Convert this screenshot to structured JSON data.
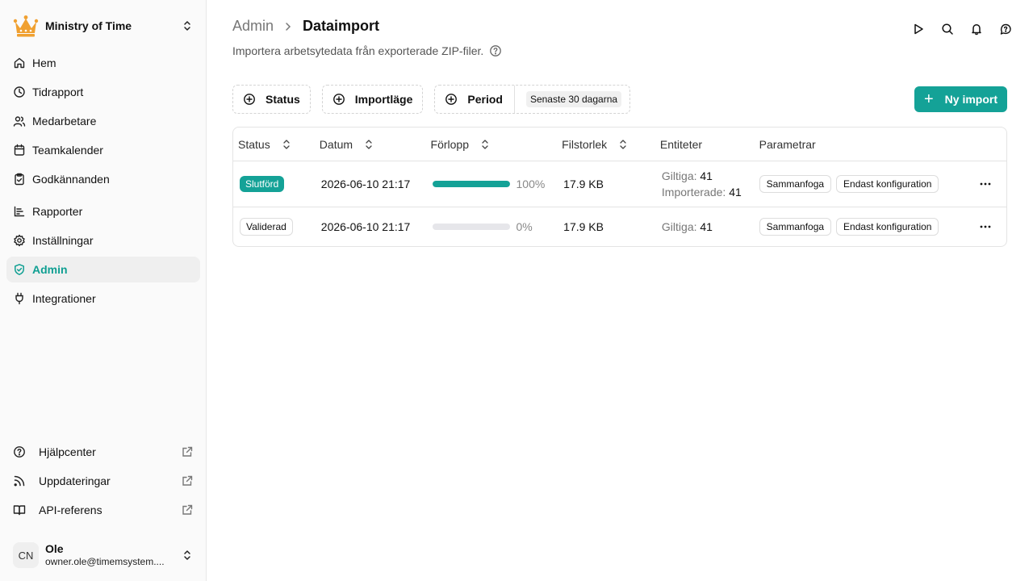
{
  "sidebar": {
    "org_name": "Ministry of Time",
    "nav": [
      {
        "label": "Hem",
        "icon": "home-icon"
      },
      {
        "label": "Tidrapport",
        "icon": "clock-icon"
      },
      {
        "label": "Medarbetare",
        "icon": "users-icon"
      },
      {
        "label": "Teamkalender",
        "icon": "calendar-icon"
      },
      {
        "label": "Godkännanden",
        "icon": "clipboard-check-icon"
      },
      {
        "label": "Rapporter",
        "icon": "chart-icon"
      },
      {
        "label": "Inställningar",
        "icon": "gear-icon"
      },
      {
        "label": "Admin",
        "icon": "shield-check-icon"
      },
      {
        "label": "Integrationer",
        "icon": "plug-icon"
      }
    ],
    "external": [
      {
        "label": "Hjälpcenter",
        "icon": "help-circle-icon"
      },
      {
        "label": "Uppdateringar",
        "icon": "rss-icon"
      },
      {
        "label": "API-referens",
        "icon": "book-icon"
      }
    ],
    "user": {
      "initials": "CN",
      "name": "Ole",
      "email": "owner.ole@timemsystem...."
    }
  },
  "header": {
    "breadcrumb_parent": "Admin",
    "title": "Dataimport",
    "subtitle": "Importera arbetsytedata från exporterade ZIP-filer."
  },
  "filters": {
    "status": "Status",
    "mode": "Importläge",
    "period": "Period",
    "period_value": "Senaste 30 dagarna"
  },
  "new_import_label": "Ny import",
  "table": {
    "columns": [
      "Status",
      "Datum",
      "Förlopp",
      "Filstorlek",
      "Entiteter",
      "Parametrar"
    ],
    "rows": [
      {
        "status": "Slutförd",
        "date": "2026-06-10 21:17",
        "progress": 100,
        "progress_label": "100%",
        "size": "17.9 KB",
        "valid_label": "Giltiga:",
        "valid": "41",
        "imported_label": "Importerade:",
        "imported": "41",
        "params": [
          "Sammanfoga",
          "Endast konfiguration"
        ]
      },
      {
        "status": "Validerad",
        "date": "2026-06-10 21:17",
        "progress": 0,
        "progress_label": "0%",
        "size": "17.9 KB",
        "valid_label": "Giltiga:",
        "valid": "41",
        "params": [
          "Sammanfoga",
          "Endast konfiguration"
        ]
      }
    ]
  },
  "colors": {
    "accent": "#14a297",
    "logo": "#f0a030"
  }
}
